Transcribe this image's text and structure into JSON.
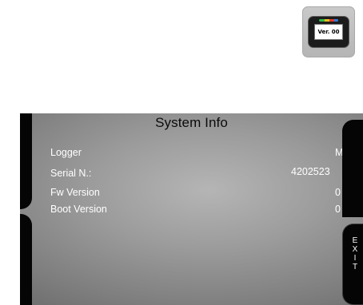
{
  "thumbnail": {
    "screen_text": "Ver. 00"
  },
  "screen": {
    "title": "System Info",
    "rows": [
      {
        "label": "Logger",
        "value": "M"
      },
      {
        "label": "Serial N.:",
        "value": "4202523"
      },
      {
        "label": "Fw Version",
        "value": "0"
      },
      {
        "label": "Boot Version",
        "value": "0"
      }
    ],
    "exit_label": "EXIT"
  }
}
